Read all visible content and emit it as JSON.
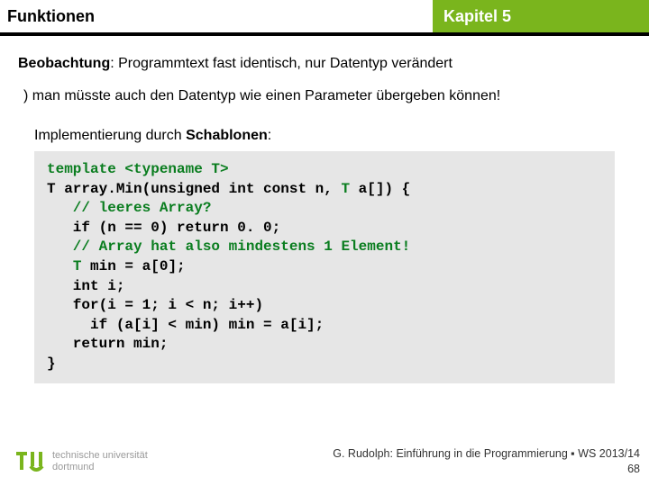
{
  "header": {
    "left": "Funktionen",
    "right": "Kapitel 5"
  },
  "observation": {
    "label": "Beobachtung",
    "text": ": Programmtext fast identisch, nur Datentyp verändert"
  },
  "consequence": ") man müsste auch den Datentyp wie einen Parameter übergeben können!",
  "implementation": {
    "prefix": "Implementierung durch ",
    "bold": "Schablonen",
    "suffix": ":"
  },
  "code": {
    "l1": "template <typename T>",
    "l2a": "T array.Min(unsigned int const n, ",
    "l2b": "T",
    "l2c": " a[]) {",
    "l3": "   // leeres Array?",
    "l4": "   if (n == 0) return 0. 0;",
    "l5": "   // Array hat also mindestens 1 Element!",
    "l6a": "   ",
    "l6b": "T",
    "l6c": " min = a[0];",
    "l7": "   int i;",
    "l8": "   for(i = 1; i < n; i++)",
    "l9": "     if (a[i] < min) min = a[i];",
    "l10": "   return min;",
    "l11": "}"
  },
  "footer": {
    "uni1": "technische universität",
    "uni2": "dortmund",
    "credit": "G. Rudolph: Einführung in die Programmierung ▪ WS 2013/14",
    "page": "68"
  }
}
